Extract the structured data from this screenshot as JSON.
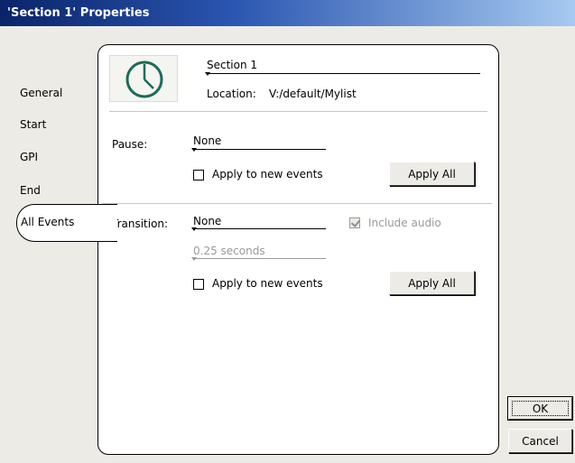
{
  "window": {
    "title": "'Section 1' Properties"
  },
  "nav": {
    "items": [
      "General",
      "Start",
      "GPI",
      "End"
    ],
    "selected": "All Events"
  },
  "header": {
    "name": "Section 1",
    "location_label": "Location:",
    "location_value": "V:/default/Mylist"
  },
  "pause": {
    "label": "Pause:",
    "value": "None",
    "apply_new_label": "Apply to new events",
    "apply_new_checked": false,
    "apply_all_label": "Apply All"
  },
  "transition": {
    "label": "Transition:",
    "value": "None",
    "include_audio_label": "Include audio",
    "include_audio_checked": true,
    "include_audio_enabled": false,
    "duration_value": "0.25 seconds",
    "apply_new_label": "Apply to new events",
    "apply_new_checked": false,
    "apply_all_label": "Apply All"
  },
  "footer": {
    "ok_label": "OK",
    "cancel_label": "Cancel"
  }
}
